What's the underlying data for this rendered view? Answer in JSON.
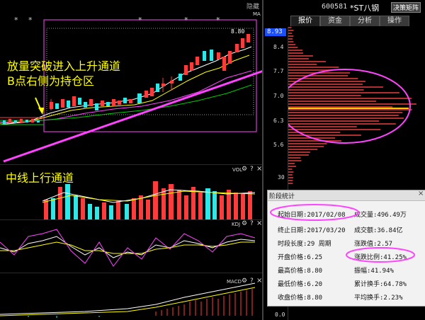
{
  "header": {
    "hide_label": "隐藏",
    "close": "×",
    "stock_code": "600581",
    "stock_name": "*ST八钢",
    "dropdown": "决策矩阵"
  },
  "tabs": [
    {
      "label": "报价"
    },
    {
      "label": "资金"
    },
    {
      "label": "分析"
    },
    {
      "label": "操作"
    }
  ],
  "main_chart": {
    "ma_label": "MA",
    "high_label": "8.80",
    "annotation_line1": "放量突破进入上升通道",
    "annotation_line2": "B点右侧为持仓区",
    "mid_annotation": "中线上行通道",
    "stars": [
      "*",
      "*",
      "*",
      "*",
      "*"
    ]
  },
  "volume_panel": {
    "label": "VOL",
    "gear": "⚙",
    "help": "?",
    "close": "×"
  },
  "kdj_panel": {
    "label": "KDJ",
    "gear": "⚙",
    "help": "?",
    "close": "×"
  },
  "macd_panel": {
    "label": "MACD",
    "gear": "⚙",
    "help": "?",
    "close": "×"
  },
  "price_axis": {
    "current": "8.93",
    "ticks": [
      "8.4",
      "7.7",
      "7.0",
      "6.3",
      "5.6"
    ],
    "vol_tick": "30",
    "zero": "0.0"
  },
  "stats": {
    "title": "阶段统计",
    "close": "×",
    "start_date": "起始日期:2017/02/08",
    "volume": "成交量:496.49万",
    "end_date": "终止日期:2017/03/20",
    "amount": "成交额:36.84亿",
    "period": "时段长度:29 周期",
    "change_val": "涨跌值:2.57",
    "open_price": "开盘价格:6.25",
    "change_pct": "涨跌比例:41.25%",
    "high_price": "最高价格:8.80",
    "amplitude": "振幅:41.94%",
    "low_price": "最低价格:6.20",
    "turnover_total": "累计换手:64.78%",
    "close_price": "收盘价格:8.80",
    "turnover_avg": "平均换手:2.23%"
  },
  "colors": {
    "up": "#ff3b3b",
    "down": "#2ee8e8",
    "ma1": "#ffffff",
    "ma2": "#ffff00",
    "ma3": "#ff44ff",
    "ma4": "#00cc00",
    "annotation": "#ff44ff",
    "text_yellow": "#ffff00"
  }
}
